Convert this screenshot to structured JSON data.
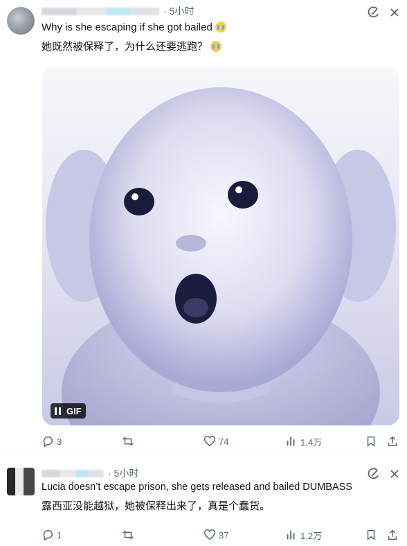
{
  "posts": [
    {
      "time": "· 5小时",
      "text_en": "Why is she escaping if she got bailed",
      "text_zh": "她既然被保释了，为什么还要逃跑？",
      "media": {
        "type": "gif",
        "badge": "GIF",
        "subject": "baby-surprised-face"
      },
      "actions": {
        "replies": "3",
        "reposts": "",
        "likes": "74",
        "views": "1.4万"
      }
    },
    {
      "time": "· 5小时",
      "text_en": "Lucia doesn’t escape prison, she gets released and bailed DUMBASS",
      "text_zh": "露西亚没能越狱，她被保释出来了，真是个蠢货。",
      "actions": {
        "replies": "1",
        "reposts": "",
        "likes": "37",
        "views": "1.2万"
      }
    }
  ],
  "icons": [
    "grok-icon",
    "close-icon",
    "reply-icon",
    "repost-icon",
    "like-icon",
    "views-icon",
    "bookmark-icon",
    "share-icon",
    "pause-icon"
  ],
  "colors": {
    "text": "#0f1419",
    "secondary": "#536471",
    "divider": "#eff3f4",
    "media_tint": "#c9cae6"
  }
}
